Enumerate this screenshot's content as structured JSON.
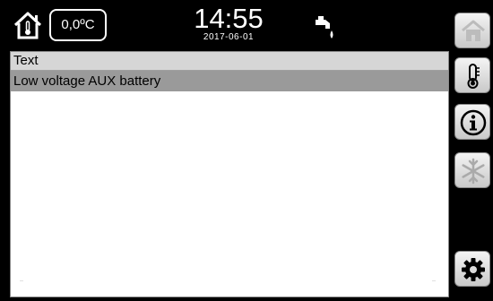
{
  "header": {
    "temperature": "0,0ºC",
    "time": "14:55",
    "date": "2017-06-01"
  },
  "table": {
    "column_header": "Text",
    "rows": [
      "Low voltage AUX battery"
    ]
  },
  "sidebar": {
    "buttons": [
      "home-icon",
      "thermometer-icon",
      "info-icon",
      "snowflake-icon",
      "gear-icon"
    ]
  },
  "colors": {
    "header_bg": "#000000",
    "header_row_bg": "#d6d6d6",
    "selected_row_bg": "#9a9a9a",
    "button_light": "#f4f4f4",
    "button_dark": "#c9c9c9"
  }
}
